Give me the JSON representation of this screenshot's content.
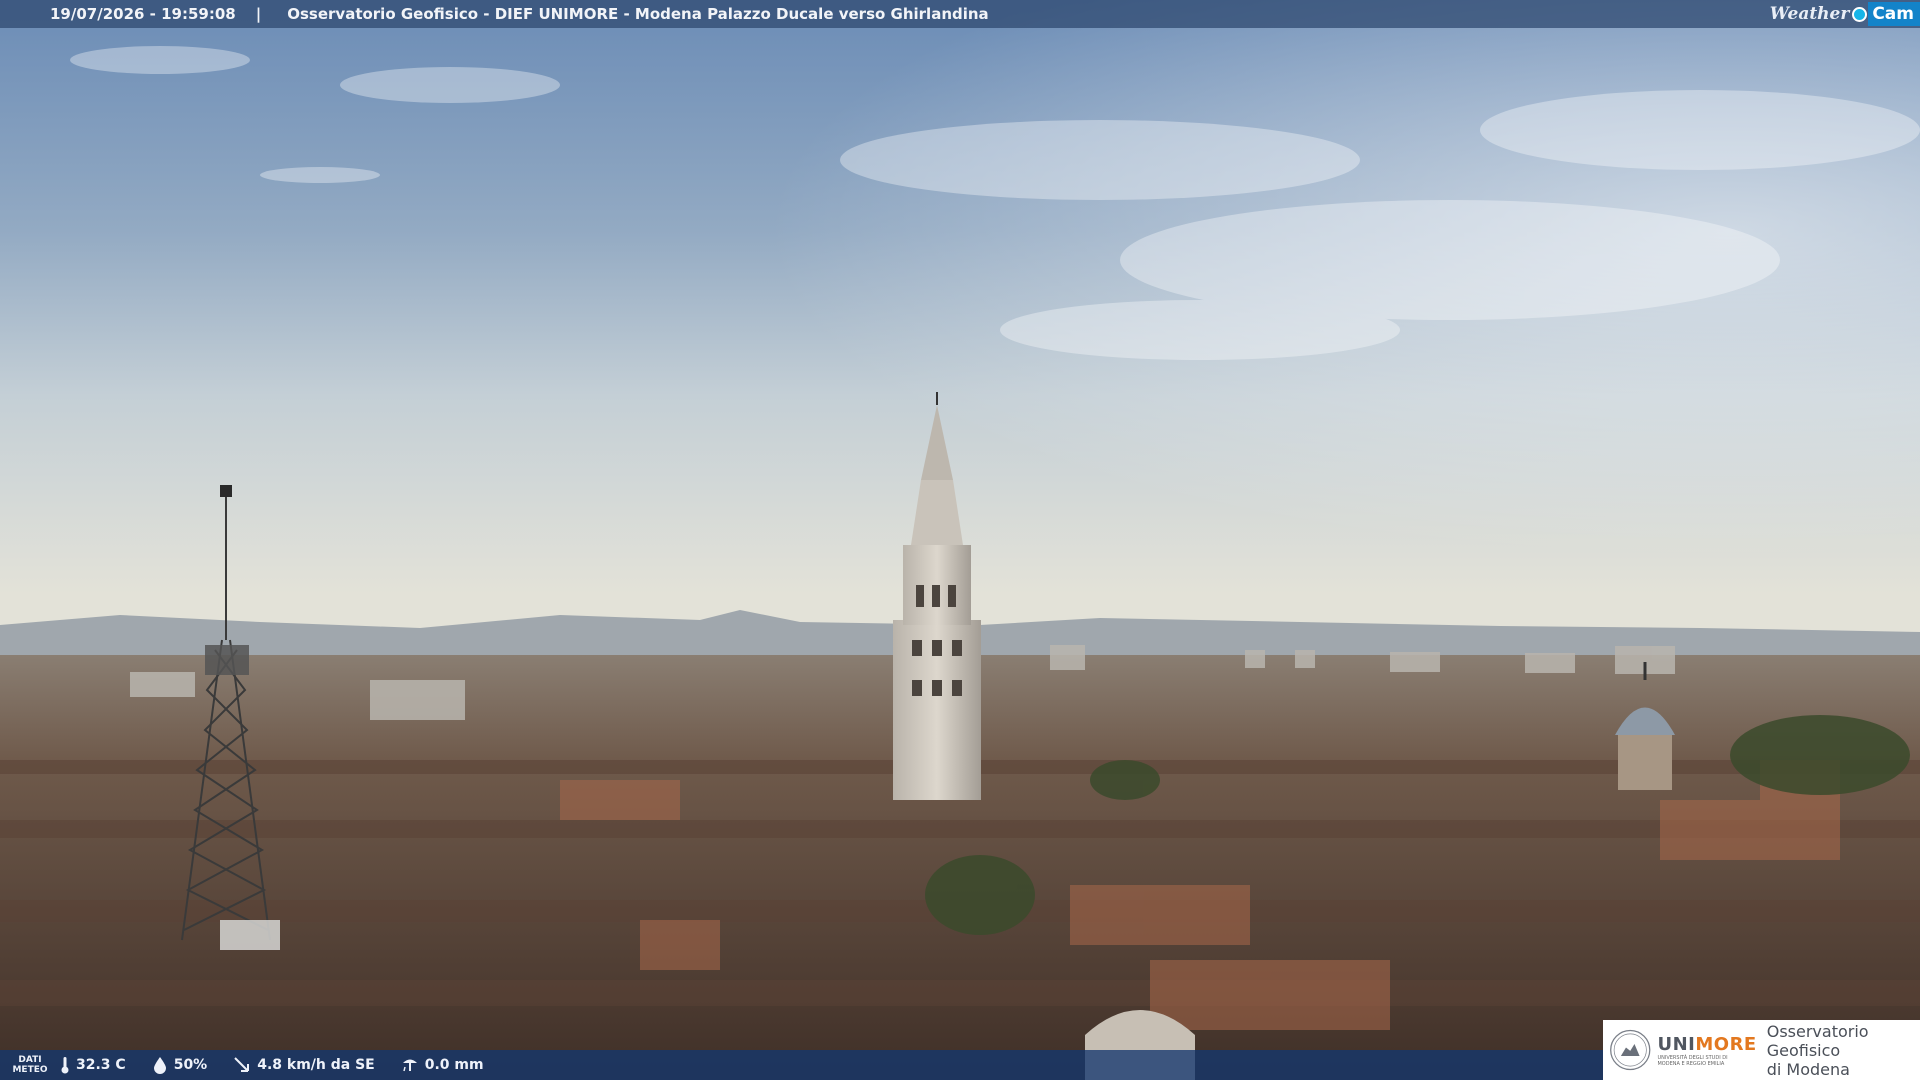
{
  "overlay": {
    "timestamp": "19/07/2026 - 19:59:08",
    "separator": "|",
    "title": "Osservatorio Geofisico - DIEF UNIMORE - Modena Palazzo Ducale verso Ghirlandina",
    "brand_weather": "Weather",
    "brand_cam": "Cam"
  },
  "weather_data": {
    "label_line1": "DATI",
    "label_line2": "METEO",
    "temperature": "32.3 C",
    "humidity": "50%",
    "wind": "4.8 km/h da SE",
    "rain": "0.0 mm"
  },
  "logo": {
    "uni_prefix": "UNI",
    "uni_suffix": "MORE",
    "uni_sub": "UNIVERSITÀ DEGLI STUDI DI MODENA E REGGIO EMILIA",
    "obs_line1": "Osservatorio Geofisico",
    "obs_line2": "di Modena"
  },
  "colors": {
    "sky_top": "#6f8fb8",
    "sky_horizon": "#e8e6da",
    "roofs": "#6b5345",
    "brand_accent": "#e3781f"
  }
}
